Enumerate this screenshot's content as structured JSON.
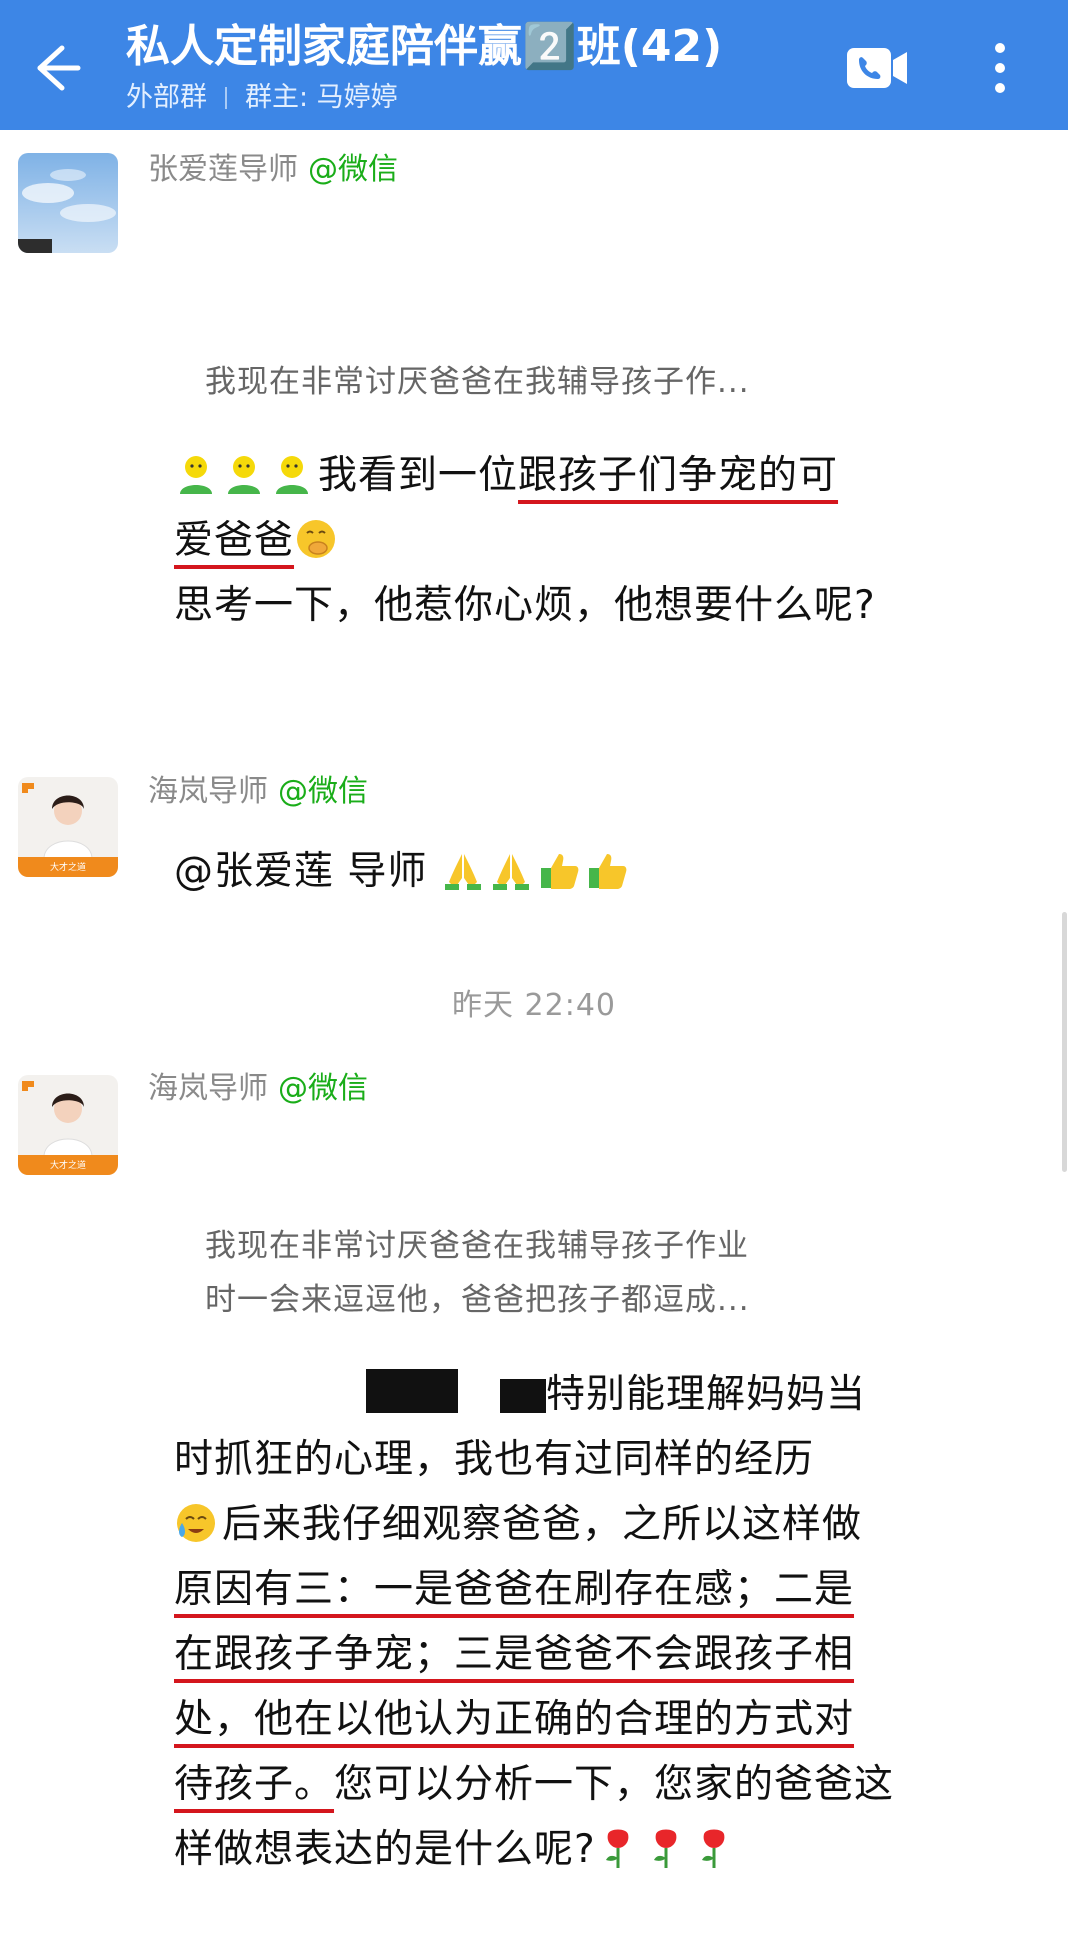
{
  "header": {
    "title": "私人定制家庭陪伴赢2️⃣班(42)",
    "subtitle_left": "外部群",
    "subtitle_right": "群主: 马婷婷"
  },
  "colors": {
    "header_bg": "#3d86e6",
    "source_green": "#1aad19",
    "highlight_red": "#d4161d"
  },
  "messages": [
    {
      "sender": "张爱莲导师",
      "source": "@微信",
      "quote": "我现在非常讨厌爸爸在我辅导孩子作...",
      "line1_pre": "我看到一位",
      "line1_hl": "跟孩子们争宠的可",
      "line2_hl": "爱爸爸",
      "line3": "思考一下，他惹你心烦，他想要什么呢?"
    },
    {
      "sender": "海岚导师",
      "source": "@微信",
      "avatar_caption": "大才之道",
      "text": "@张爱莲 导师 "
    },
    {
      "time": "昨天  22:40"
    },
    {
      "sender": "海岚导师",
      "source": "@微信",
      "avatar_caption": "大才之道",
      "quote_line1": "我现在非常讨厌爸爸在我辅导孩子作业",
      "quote_line2": "时一会来逗逗他，爸爸把孩子都逗成...",
      "p1": "特别能理解妈妈当时抓狂的心理，我也有过同样的经历",
      "p2": "后来我仔细观察爸爸，之所以这样做",
      "hl_a": "原因有三：一是爸爸在刷存在感；二是",
      "hl_b": "在跟孩子争宠；三是爸爸不会跟孩子相",
      "hl_c": "处，他在以他认为正确的合理的方式对",
      "hl_d": "待孩子。",
      "p3": "您可以分析一下，您家的爸爸这样做想表达的是什么呢?"
    }
  ]
}
